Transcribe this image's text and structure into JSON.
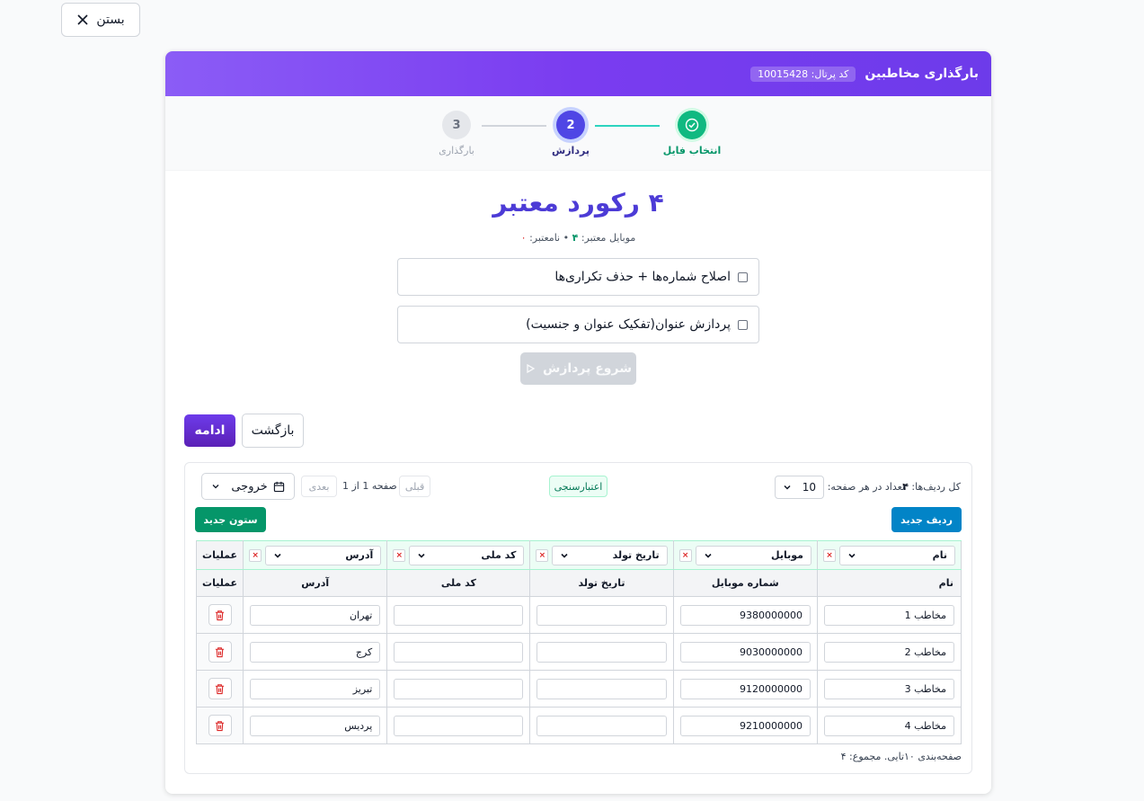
{
  "close_label": "بستن",
  "header": {
    "title": "بارگذاری مخاطبین",
    "portal_code": "کد پرتال: 10015428"
  },
  "steps": [
    {
      "label": "انتخاب فایل",
      "status": "done"
    },
    {
      "label": "پردازش",
      "number": "2",
      "status": "active"
    },
    {
      "label": "بارگذاری",
      "number": "3",
      "status": "pending"
    }
  ],
  "summary": {
    "title": "۴ رکورد معتبر",
    "valid_mobile_label": "موبایل معتبر:",
    "valid_mobile_count": "۴",
    "separator": "•",
    "invalid_label": "نامعتبر:",
    "invalid_count": "۰"
  },
  "options": [
    {
      "label": "اصلاح شماره‌ها + حذف تکراری‌ها",
      "checked": false
    },
    {
      "label": "پردازش عنوان(تفکیک عنوان و جنسیت)",
      "checked": false
    }
  ],
  "start_button": "شروع پردازش",
  "nav": {
    "continue": "ادامه",
    "back": "بازگشت"
  },
  "table_toolbar": {
    "total_rows_label": "کل ردیف‌ها:",
    "total_rows": "۴",
    "per_page_label": "تعداد در هر صفحه:",
    "per_page": "10",
    "validate": "اعتبارسنجی",
    "prev": "قبلی",
    "page_info": "صفحه 1 از 1",
    "next": "بعدی",
    "export": "خروجی",
    "new_row": "ردیف جدید",
    "new_column": "ستون جدید"
  },
  "mapping": [
    "نام",
    "موبایل",
    "تاریخ تولد",
    "کد ملی",
    "آدرس"
  ],
  "operations_label": "عملیات",
  "columns": [
    "نام",
    "شماره موبایل",
    "تاریخ تولد",
    "کد ملی",
    "آدرس"
  ],
  "rows": [
    [
      "مخاطب 1",
      "9380000000",
      "",
      "",
      "تهران"
    ],
    [
      "مخاطب 2",
      "9030000000",
      "",
      "",
      "کرج"
    ],
    [
      "مخاطب 3",
      "9120000000",
      "",
      "",
      "تبریز"
    ],
    [
      "مخاطب 4",
      "9210000000",
      "",
      "",
      "پردیس"
    ]
  ],
  "footer_note": "صفحه‌بندی ۱۰تایی. مجموع: ۴",
  "colors": {
    "primary": "#6d3bea",
    "success": "#059669",
    "info": "#0284c7",
    "danger": "#dc2626"
  }
}
